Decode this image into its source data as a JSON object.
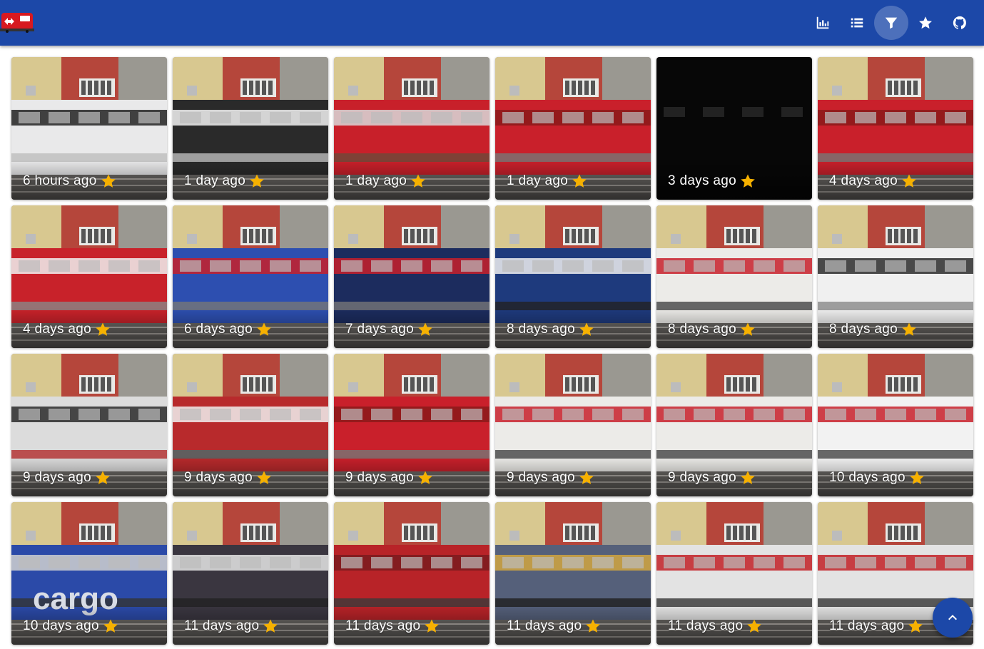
{
  "app": {
    "brand_color": "#1c48a8",
    "accent_star_color": "#f6b100"
  },
  "toolbar": [
    {
      "name": "stats-button",
      "icon": "bar-chart-icon",
      "active": false
    },
    {
      "name": "list-button",
      "icon": "list-icon",
      "active": false
    },
    {
      "name": "filter-button",
      "icon": "filter-icon",
      "active": true
    },
    {
      "name": "favorites-button",
      "icon": "star-icon",
      "active": false
    },
    {
      "name": "github-button",
      "icon": "github-icon",
      "active": false
    }
  ],
  "gallery": {
    "items": [
      {
        "label": "6 hours ago",
        "train": "white-double-decker",
        "favorite": true
      },
      {
        "label": "1 day ago",
        "train": "black-white-bls",
        "favorite": true
      },
      {
        "label": "1 day ago",
        "train": "red-locomotive-flatcar",
        "favorite": true
      },
      {
        "label": "1 day ago",
        "train": "red-locomotive",
        "favorite": true
      },
      {
        "label": "3 days ago",
        "train": "night-train",
        "favorite": true
      },
      {
        "label": "4 days ago",
        "train": "red-locomotive",
        "favorite": true
      },
      {
        "label": "4 days ago",
        "train": "red-sbb-locomotive",
        "favorite": true
      },
      {
        "label": "6 days ago",
        "train": "blue-cargo-locomotive",
        "favorite": true
      },
      {
        "label": "7 days ago",
        "train": "blue-locomotive-front",
        "favorite": true
      },
      {
        "label": "8 days ago",
        "train": "blue-sbb-coach",
        "favorite": true
      },
      {
        "label": "8 days ago",
        "train": "white-red-double-decker",
        "favorite": true
      },
      {
        "label": "8 days ago",
        "train": "white-thurbo",
        "favorite": true
      },
      {
        "label": "9 days ago",
        "train": "blurred-double-decker",
        "favorite": true
      },
      {
        "label": "9 days ago",
        "train": "red-cargo-container",
        "favorite": true
      },
      {
        "label": "9 days ago",
        "train": "red-locomotive",
        "favorite": true
      },
      {
        "label": "9 days ago",
        "train": "white-red-double-decker",
        "favorite": true
      },
      {
        "label": "9 days ago",
        "train": "white-red-double-decker",
        "favorite": true
      },
      {
        "label": "10 days ago",
        "train": "white-kiss-front",
        "favorite": true
      },
      {
        "label": "10 days ago",
        "train": "blue-cargo",
        "favorite": true
      },
      {
        "label": "11 days ago",
        "train": "blurred-dark",
        "favorite": true
      },
      {
        "label": "11 days ago",
        "train": "blurred-red",
        "favorite": true
      },
      {
        "label": "11 days ago",
        "train": "blurred-graffiti",
        "favorite": true
      },
      {
        "label": "11 days ago",
        "train": "blurred-white-red",
        "favorite": true
      },
      {
        "label": "11 days ago",
        "train": "blurred-white-red",
        "favorite": true
      }
    ],
    "cargo_text": "cargo"
  },
  "fab": {
    "icon": "chevron-up-icon"
  }
}
